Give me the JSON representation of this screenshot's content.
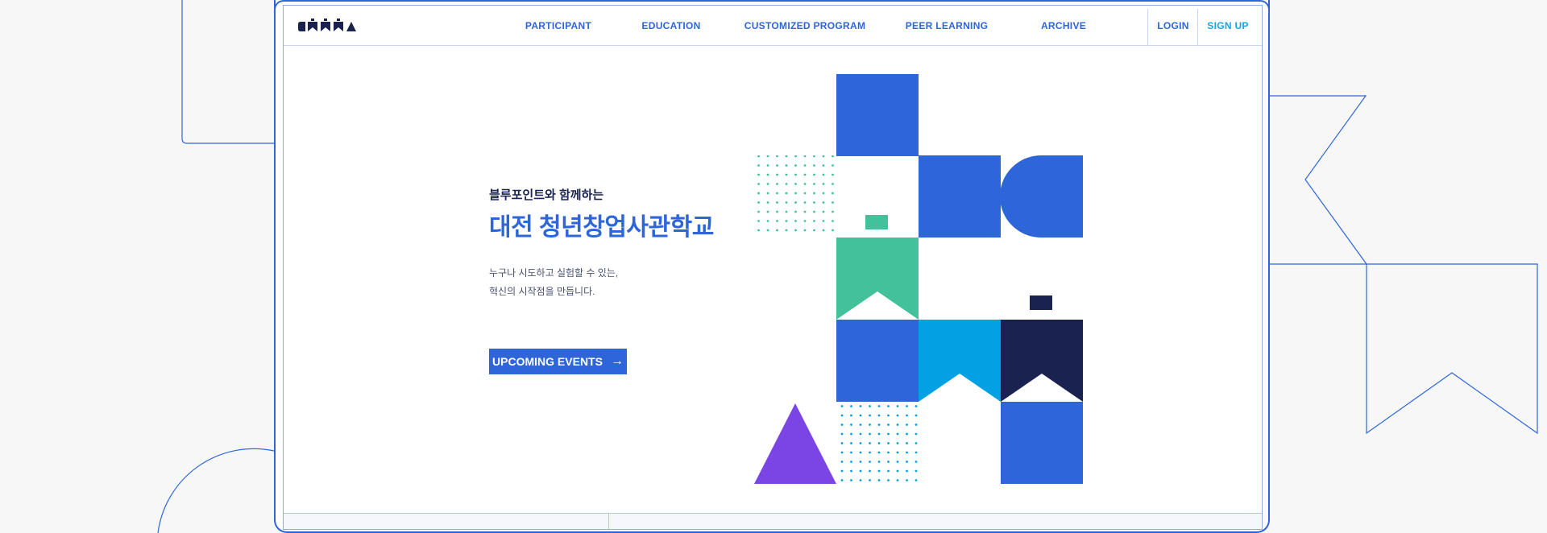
{
  "nav": {
    "logo_icon": "logo-shapes",
    "links": [
      "PARTICIPANT",
      "EDUCATION",
      "CUSTOMIZED PROGRAM",
      "PEER LEARNING",
      "ARCHIVE"
    ],
    "login": "LOGIN",
    "signup": "SIGN UP"
  },
  "hero": {
    "subtitle": "블루포인트와 함께하는",
    "title": "대전 청년창업사관학교",
    "description_line1": "누구나 시도하고 실험할 수 있는,",
    "description_line2": "혁신의 시작점을 만듭니다.",
    "cta_label": "UPCOMING EVENTS",
    "cta_icon": "arrow-right-icon"
  },
  "colors": {
    "primary": "#2e66d9",
    "navy": "#1a2350",
    "green": "#42c19b",
    "cyan": "#03a0e3",
    "purple": "#7b45e6"
  }
}
